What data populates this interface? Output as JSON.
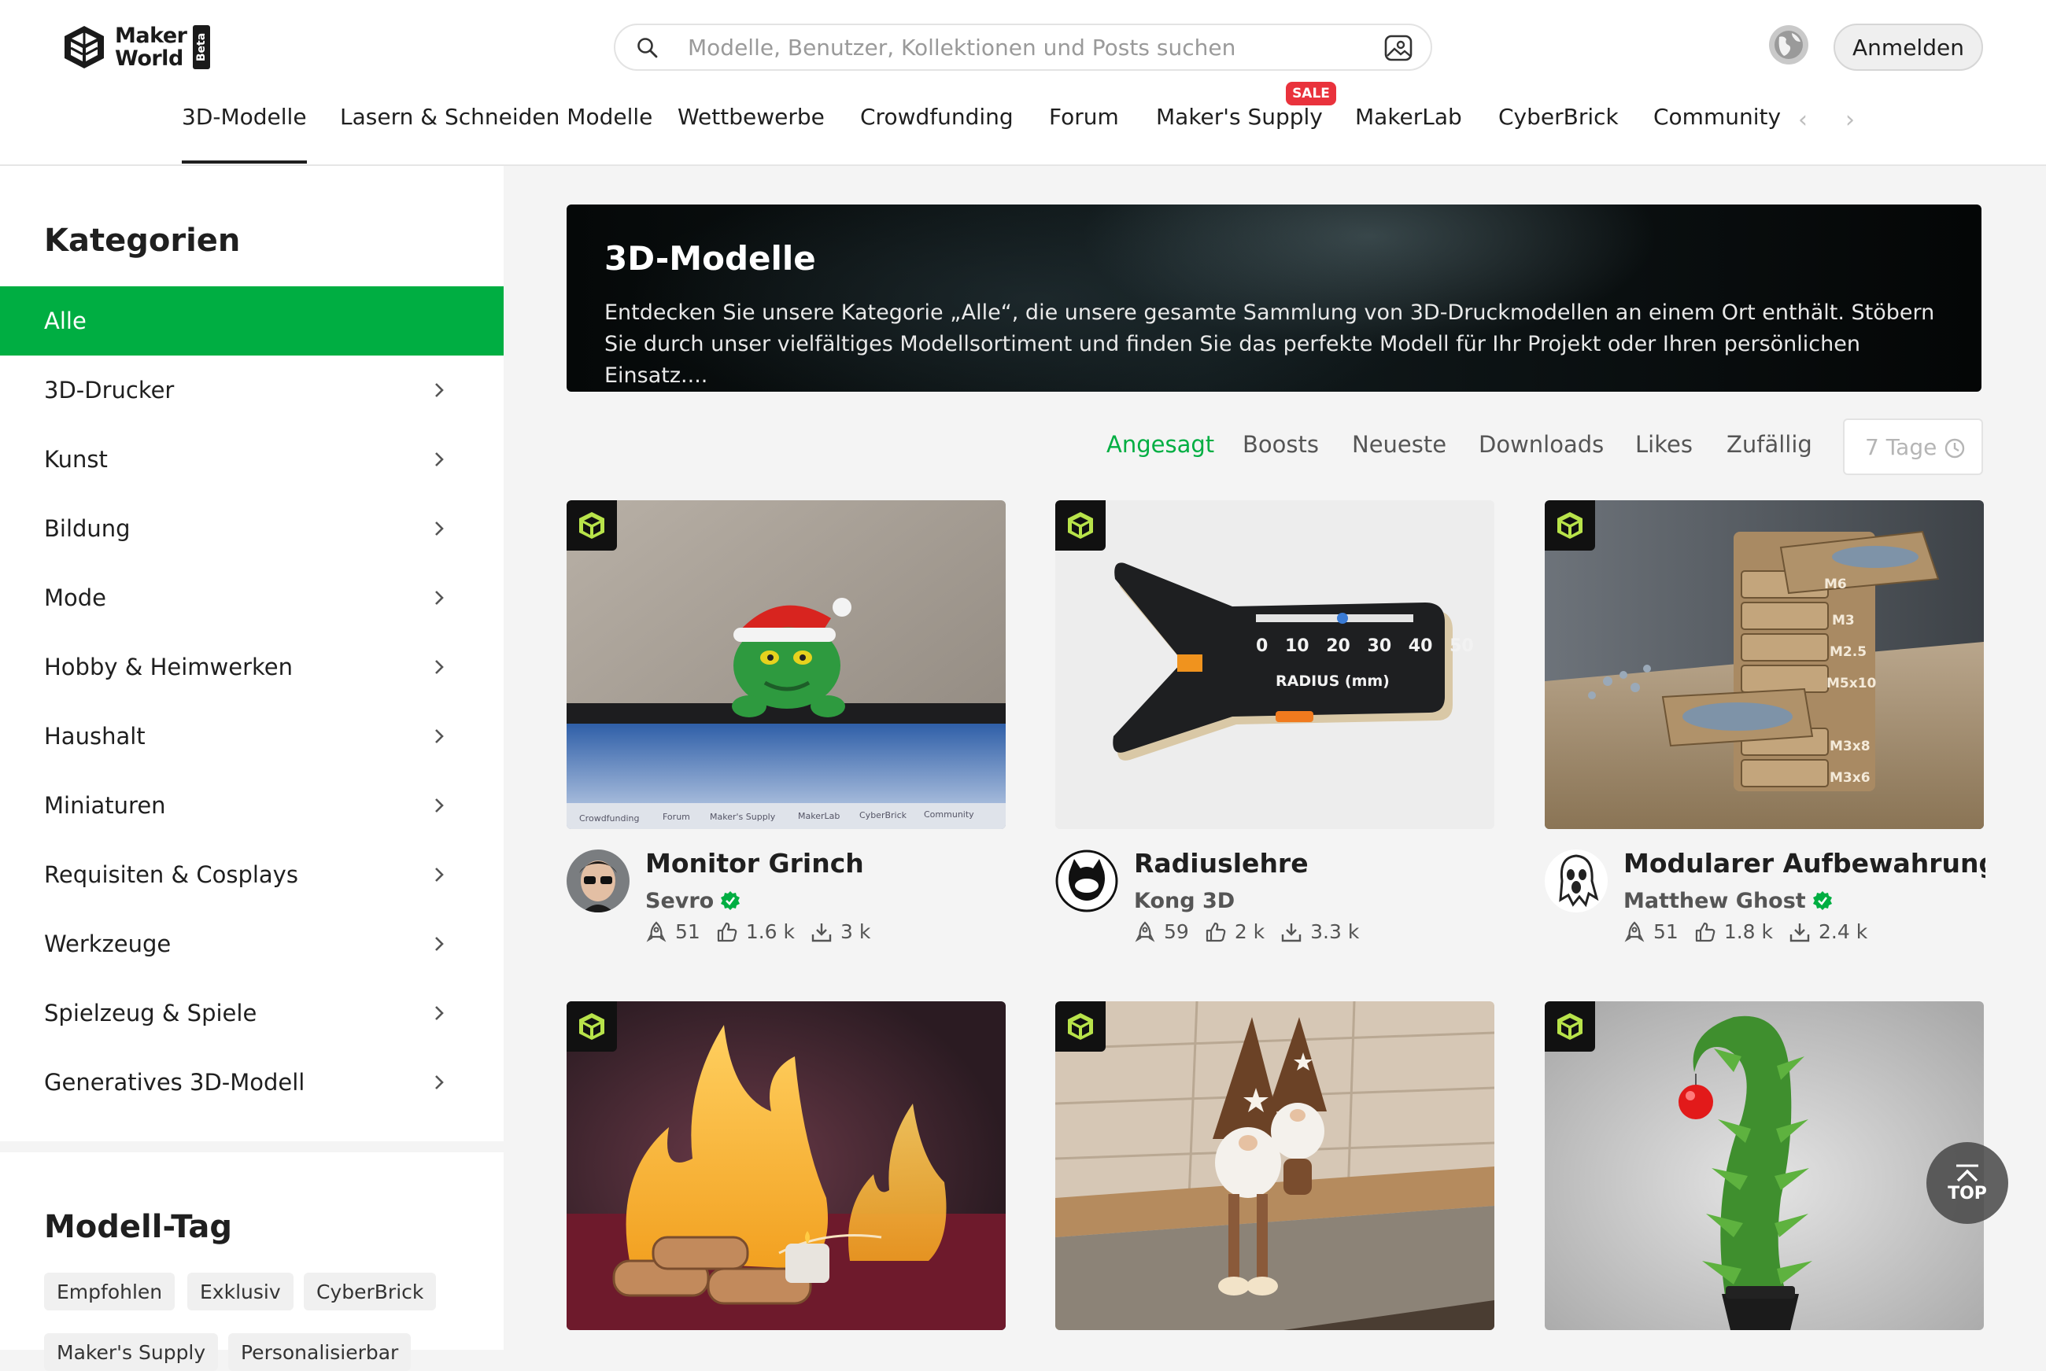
{
  "header": {
    "logo_line1": "Maker",
    "logo_line2": "World",
    "logo_beta": "Beta",
    "search_placeholder": "Modelle, Benutzer, Kollektionen und Posts suchen",
    "login_label": "Anmelden"
  },
  "nav": {
    "items": [
      "3D-Modelle",
      "Lasern & Schneiden Modelle",
      "Wettbewerbe",
      "Crowdfunding",
      "Forum",
      "Maker's Supply",
      "MakerLab",
      "CyberBrick",
      "Community"
    ],
    "sale_badge": "SALE"
  },
  "sidebar": {
    "title": "Kategorien",
    "categories": [
      "Alle",
      "3D-Drucker",
      "Kunst",
      "Bildung",
      "Mode",
      "Hobby & Heimwerken",
      "Haushalt",
      "Miniaturen",
      "Requisiten & Cosplays",
      "Werkzeuge",
      "Spielzeug & Spiele",
      "Generatives 3D-Modell"
    ],
    "tag_title": "Modell-Tag",
    "tags": [
      "Empfohlen",
      "Exklusiv",
      "CyberBrick",
      "Maker's Supply",
      "Personalisierbar"
    ]
  },
  "banner": {
    "title": "3D-Modelle",
    "text": "Entdecken Sie unsere Kategorie „Alle“, die unsere gesamte Sammlung von 3D-Druckmodellen an einem Ort enthält. Stöbern Sie durch unser vielfältiges Modellsortiment und finden Sie das perfekte Modell für Ihr Projekt oder Ihren persönlichen Einsatz...."
  },
  "sort": {
    "options": [
      "Angesagt",
      "Boosts",
      "Neueste",
      "Downloads",
      "Likes",
      "Zufällig"
    ],
    "active": "Angesagt",
    "period": "7 Tage"
  },
  "cards": [
    {
      "title": "Monitor Grinch",
      "author": "Sevro",
      "verified": true,
      "boosts": "51",
      "likes": "1.6 k",
      "downloads": "3 k"
    },
    {
      "title": "Radiuslehre",
      "author": "Kong 3D",
      "verified": false,
      "boosts": "59",
      "likes": "2 k",
      "downloads": "3.3 k"
    },
    {
      "title": "Modularer Aufbewahrungs...",
      "author": "Matthew Ghost",
      "verified": true,
      "boosts": "51",
      "likes": "1.8 k",
      "downloads": "2.4 k"
    },
    {
      "title": "",
      "author": "",
      "verified": false,
      "boosts": "",
      "likes": "",
      "downloads": ""
    },
    {
      "title": "",
      "author": "",
      "verified": false,
      "boosts": "",
      "likes": "",
      "downloads": ""
    },
    {
      "title": "",
      "author": "",
      "verified": false,
      "boosts": "",
      "likes": "",
      "downloads": ""
    }
  ],
  "card2_image_text": {
    "scale": "0 10 20 30 40 50",
    "label": "RADIUS (mm)"
  },
  "card3_image_text": [
    "M6",
    "M3",
    "M2.5",
    "M5x10",
    "M3x8",
    "M3x6"
  ],
  "card1_image_text": [
    "Crowdfunding",
    "Forum",
    "Maker's Supply",
    "MakerLab",
    "CyberBrick",
    "Community"
  ],
  "top_button": "TOP",
  "colors": {
    "accent": "#00ae42",
    "sale": "#e9323c",
    "banner": "#0b1113"
  }
}
